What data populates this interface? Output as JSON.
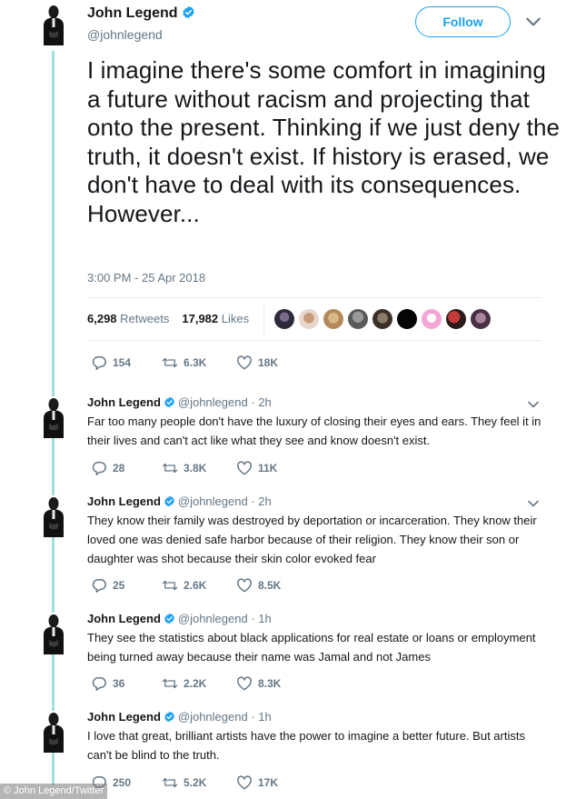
{
  "colors": {
    "accent": "#1da1f2",
    "thread": "#9fe0dc",
    "muted": "#657786",
    "text": "#14171a"
  },
  "main": {
    "name": "John Legend",
    "handle": "@johnlegend",
    "follow_label": "Follow",
    "text": "I imagine there's some comfort in imagining a future without racism and projecting that onto the present. Thinking if we just deny the truth, it doesn't exist. If history is erased, we don't have to deal with its consequences. However...",
    "timestamp": "3:00 PM - 25 Apr 2018",
    "retweets_count": "6,298",
    "retweets_label": "Retweets",
    "likes_count": "17,982",
    "likes_label": "Likes",
    "replies": "154",
    "retweets": "6.3K",
    "likes": "18K"
  },
  "replies": [
    {
      "name": "John Legend",
      "handle": "@johnlegend",
      "time": "· 2h",
      "text": "Far too many people don't have the luxury of closing their eyes and ears. They feel it in their lives and can't act like what they see and know doesn't exist.",
      "replies": "28",
      "retweets": "3.8K",
      "likes": "11K"
    },
    {
      "name": "John Legend",
      "handle": "@johnlegend",
      "time": "· 2h",
      "text": "They know their family was destroyed by deportation or incarceration. They know their loved one was denied safe harbor because of their religion. They know their son or daughter was shot because their skin color evoked fear",
      "replies": "25",
      "retweets": "2.6K",
      "likes": "8.5K"
    },
    {
      "name": "John Legend",
      "handle": "@johnlegend",
      "time": "· 1h",
      "text": "They see the statistics about black applications for real estate or loans or employment being turned away because their name was Jamal and not James",
      "replies": "36",
      "retweets": "2.2K",
      "likes": "8.3K"
    },
    {
      "name": "John Legend",
      "handle": "@johnlegend",
      "time": "· 1h",
      "text": "I love that great, brilliant artists have the power to imagine a better future. But artists can't be blind to the truth.",
      "replies": "250",
      "retweets": "5.2K",
      "likes": "17K"
    }
  ],
  "watermark": "© John Legend/Twitter"
}
